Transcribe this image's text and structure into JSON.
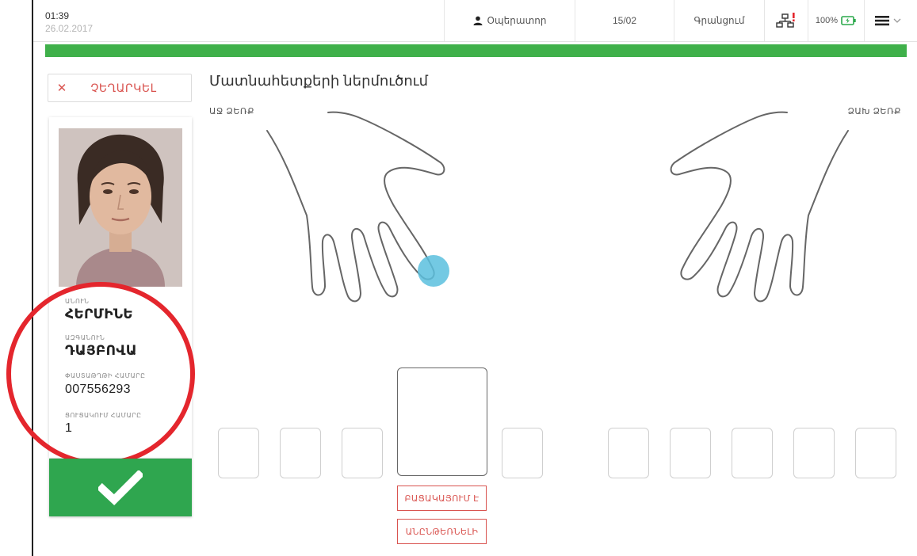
{
  "status": {
    "time": "01:39",
    "date": "26.02.2017"
  },
  "topbar": {
    "operator_label": "Օպերատոր",
    "count": "15/02",
    "registering_label": "Գրանցում",
    "battery": "100%"
  },
  "progress": {
    "percent": 100,
    "color": "#3fb04a"
  },
  "sidebar": {
    "cancel_label": "ՉԵՂԱՐԿԵԼ",
    "fields": {
      "first_name_label": "ԱՆՈՒՆ",
      "first_name": "ՀԵՐՄԻՆԵ",
      "last_name_label": "ԱԶԳԱՆՈՒՆ",
      "last_name": "ԴԱՅԲՈՎԱ",
      "passport_label": "ՓԱՍՏԱԹՂԹԻ ՀԱՄԱՐԸ",
      "passport": "007556293",
      "list_number_label": "ՑՈՒՑԱԿՈՒՄ ՀԱՄԱՐԸ",
      "list_number": "1"
    }
  },
  "main": {
    "title": "Մատնահետքերի ներմուծում",
    "right_hand_label": "ԱՋ ՁԵՌՔ",
    "left_hand_label": "ՁԱԽ ՁԵՌՔ",
    "missing_label": "ԲԱՑԱԿԱՅՈՒՄ Է",
    "unreadable_label": "ԱՆԸՆԹԵՌՆԵԼԻ"
  },
  "colors": {
    "accent_green": "#2fa64f",
    "danger": "#d9534f",
    "highlight_circle": "#e4262d",
    "finger_marker": "#5bc0de"
  },
  "icons": [
    "user-icon",
    "network-alert-icon",
    "battery-icon",
    "menu-icon",
    "chevron-down-icon",
    "close-icon",
    "checkmark-icon"
  ]
}
